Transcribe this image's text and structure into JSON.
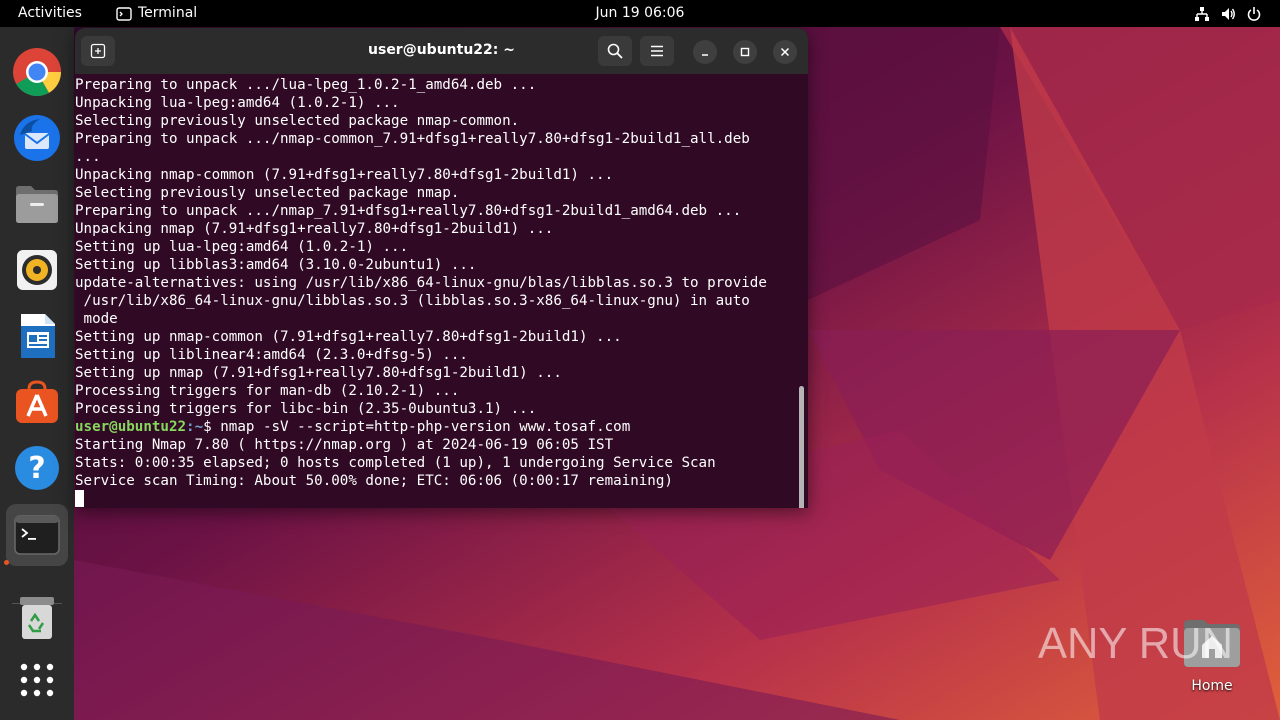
{
  "topbar": {
    "activities": "Activities",
    "app_name": "Terminal",
    "clock": "Jun 19  06:06",
    "tray_icons": [
      "network-icon",
      "volume-icon",
      "power-icon"
    ]
  },
  "dock": {
    "apps": [
      "chrome-icon",
      "thunderbird-icon",
      "files-icon",
      "rhythmbox-icon",
      "writer-icon",
      "app-center-icon",
      "help-icon",
      "terminal-icon",
      "trash-icon",
      "app-grid-icon"
    ]
  },
  "terminal": {
    "title": "user@ubuntu22: ~",
    "lines": [
      "Preparing to unpack .../lua-lpeg_1.0.2-1_amd64.deb ...",
      "Unpacking lua-lpeg:amd64 (1.0.2-1) ...",
      "Selecting previously unselected package nmap-common.",
      "Preparing to unpack .../nmap-common_7.91+dfsg1+really7.80+dfsg1-2build1_all.deb",
      "...",
      "Unpacking nmap-common (7.91+dfsg1+really7.80+dfsg1-2build1) ...",
      "Selecting previously unselected package nmap.",
      "Preparing to unpack .../nmap_7.91+dfsg1+really7.80+dfsg1-2build1_amd64.deb ...",
      "Unpacking nmap (7.91+dfsg1+really7.80+dfsg1-2build1) ...",
      "Setting up lua-lpeg:amd64 (1.0.2-1) ...",
      "Setting up libblas3:amd64 (3.10.0-2ubuntu1) ...",
      "update-alternatives: using /usr/lib/x86_64-linux-gnu/blas/libblas.so.3 to provide",
      " /usr/lib/x86_64-linux-gnu/libblas.so.3 (libblas.so.3-x86_64-linux-gnu) in auto",
      " mode",
      "Setting up nmap-common (7.91+dfsg1+really7.80+dfsg1-2build1) ...",
      "Setting up liblinear4:amd64 (2.3.0+dfsg-5) ...",
      "Setting up nmap (7.91+dfsg1+really7.80+dfsg1-2build1) ...",
      "Processing triggers for man-db (2.10.2-1) ...",
      "Processing triggers for libc-bin (2.35-0ubuntu3.1) ..."
    ],
    "prompt_user": "user@ubuntu22",
    "prompt_dir": ":~",
    "prompt_symbol": "$ ",
    "command": "nmap -sV --script=http-php-version www.tosaf.com",
    "output_lines": [
      "Starting Nmap 7.80 ( https://nmap.org ) at 2024-06-19 06:05 IST",
      "Stats: 0:00:35 elapsed; 0 hosts completed (1 up), 1 undergoing Service Scan",
      "Service scan Timing: About 50.00% done; ETC: 06:06 (0:00:17 remaining)"
    ]
  },
  "desktop": {
    "home_label": "Home",
    "watermark": "ANY RUN"
  }
}
